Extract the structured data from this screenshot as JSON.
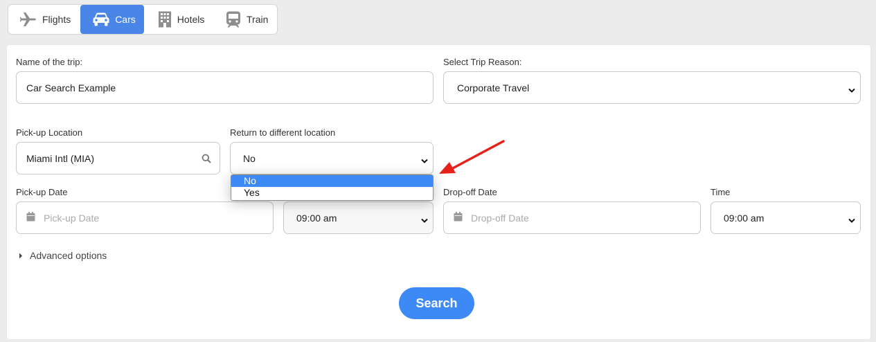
{
  "tabs": [
    {
      "label": "Flights",
      "icon": "airplane-icon"
    },
    {
      "label": "Cars",
      "icon": "car-icon",
      "active": true
    },
    {
      "label": "Hotels",
      "icon": "building-icon"
    },
    {
      "label": "Train",
      "icon": "train-icon"
    }
  ],
  "form": {
    "trip_name_label": "Name of the trip:",
    "trip_name_value": "Car Search Example",
    "trip_reason_label": "Select Trip Reason:",
    "trip_reason_value": "Corporate Travel",
    "pickup_location_label": "Pick-up Location",
    "pickup_location_value": "Miami Intl (MIA)",
    "return_label": "Return to different location",
    "return_value": "No",
    "return_options": [
      "No",
      "Yes"
    ],
    "pickup_date_label": "Pick-up Date",
    "pickup_date_placeholder": "Pick-up Date",
    "pickup_time_value": "09:00 am",
    "dropoff_date_label": "Drop-off Date",
    "dropoff_date_placeholder": "Drop-off Date",
    "time_label": "Time",
    "dropoff_time_value": "09:00 am",
    "advanced_label": "Advanced options",
    "search_label": "Search"
  },
  "colors": {
    "accent": "#3d8af7",
    "tab_active": "#4a86e8",
    "annotation_arrow": "#e8201a"
  }
}
